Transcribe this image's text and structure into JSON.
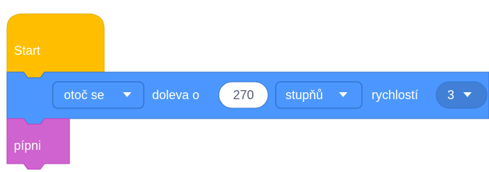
{
  "colors": {
    "start_block": "#ffbf00",
    "motion_block": "#4c97ff",
    "sound_block": "#cf63cf",
    "dropdown_fill": "#4280d7",
    "number_input_fill": "#ffffff",
    "block_outline": "#3373cc"
  },
  "start_block": {
    "label": "Start"
  },
  "turn_block": {
    "direction_dropdown": {
      "value": "otoč se",
      "icon": "dropdown-arrow-icon"
    },
    "text_direction": "doleva o",
    "angle_input": {
      "value": "270"
    },
    "unit_dropdown": {
      "value": "stupňů",
      "icon": "dropdown-arrow-icon"
    },
    "text_speed": "rychlostí",
    "speed_dropdown": {
      "value": "3",
      "icon": "dropdown-arrow-icon"
    }
  },
  "beep_block": {
    "label": "pípni"
  }
}
